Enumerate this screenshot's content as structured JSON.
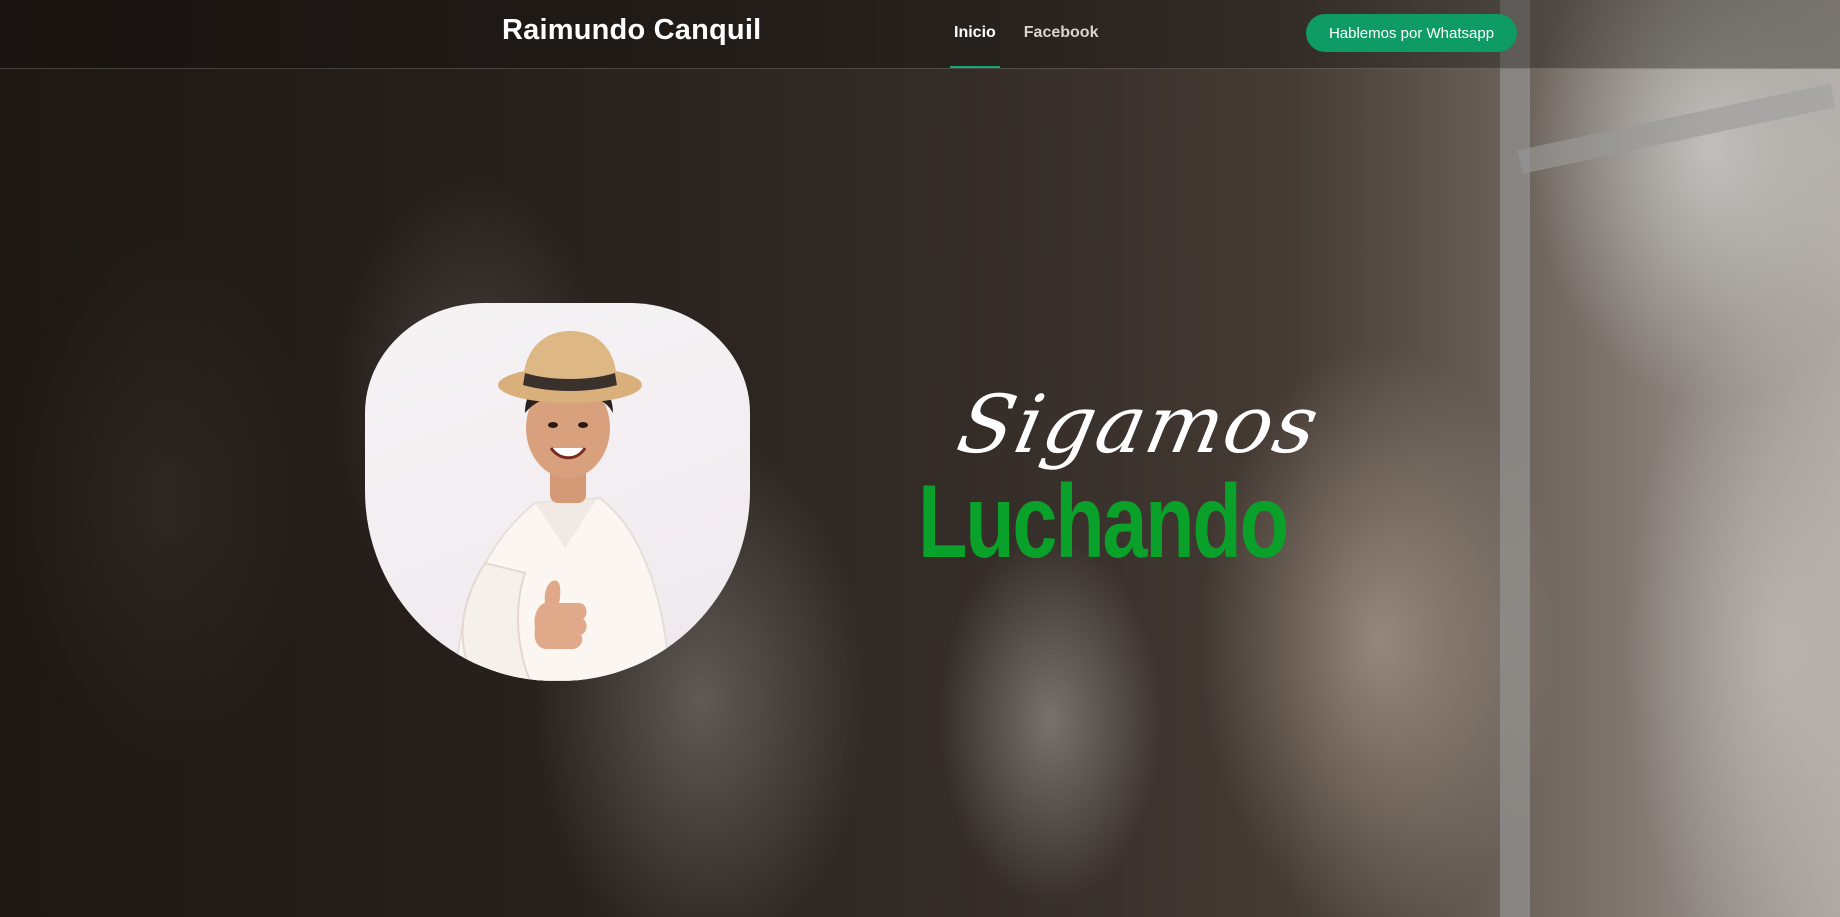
{
  "header": {
    "brand": "Raimundo Canquil",
    "nav": [
      {
        "label": "Inicio",
        "active": true
      },
      {
        "label": "Facebook",
        "active": false
      }
    ],
    "cta_label": "Hablemos por Whatsapp"
  },
  "hero": {
    "script_word": "Sigamos",
    "bold_word": "Luchando",
    "portrait_icon": "portrait-photo"
  },
  "colors": {
    "accent_green": "#0aa12a",
    "cta_green": "#0f9b66",
    "nav_underline": "#17a673"
  }
}
